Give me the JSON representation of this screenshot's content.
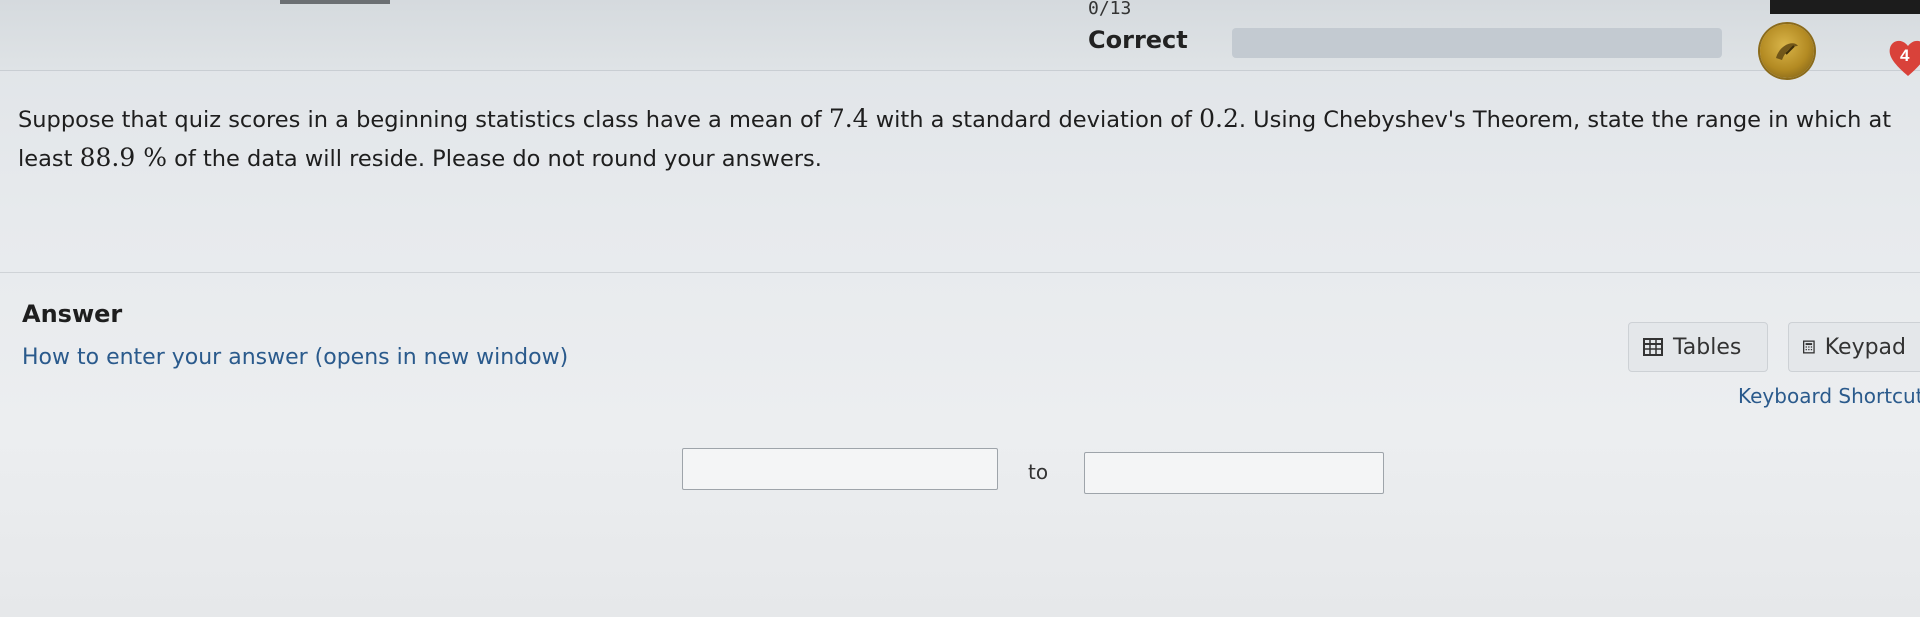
{
  "header": {
    "progress_count": "0/13",
    "status": "Correct",
    "progress_fraction": 0.0,
    "medal_icon": "medal-icon",
    "lives": "4",
    "accent_heart": "#d9423a"
  },
  "question": {
    "part1": "Suppose that quiz scores in a beginning statistics class have a mean of ",
    "mean": "7.4",
    "part2": " with a standard deviation of ",
    "sd": "0.2",
    "part3": ".  Using Chebyshev's Theorem, state the range in which at least ",
    "percent": "88.9 %",
    "part4": "  of the data will reside.  Please do not round your answers."
  },
  "answer": {
    "label": "Answer",
    "howto_link": "How to enter your answer (opens in new window)",
    "tables_label": "Tables",
    "keypad_label": "Keypad",
    "keyboard_shortcuts": "Keyboard Shortcuts",
    "lower_value": "",
    "upper_value": "",
    "to_text": "to"
  },
  "colors": {
    "link": "#2a5a8c",
    "text": "#1e1e1e",
    "background": "#e9ecef"
  }
}
